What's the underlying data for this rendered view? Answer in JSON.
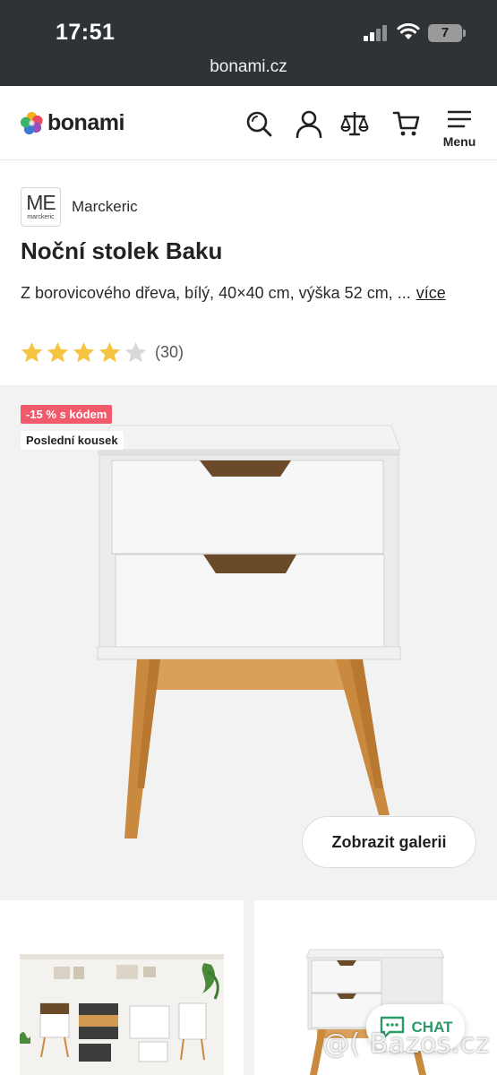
{
  "status_bar": {
    "time": "17:51",
    "battery": "7",
    "url": "bonami.cz"
  },
  "header": {
    "logo_text": "bonami",
    "icons": [
      "search-icon",
      "user-icon",
      "compare-icon",
      "cart-icon",
      "menu-icon"
    ],
    "menu_label": "Menu"
  },
  "product": {
    "brand_logo_letters": "ME",
    "brand_logo_small": "marckeric",
    "brand": "Marckeric",
    "title": "Noční stolek Baku",
    "description": "Z borovicového dřeva, bílý, 40×40 cm, výška 52 cm, ...",
    "more_link": "více",
    "rating_value": 4,
    "rating_max": 5,
    "rating_count": "(30)"
  },
  "gallery": {
    "badge_discount": "-15 % s kódem",
    "badge_last": "Poslední kousek",
    "show_gallery_button": "Zobrazit galerii"
  },
  "chat": {
    "label": "CHAT"
  },
  "watermark": "@( Bazos.cz",
  "colors": {
    "status_bar_bg": "#2f3336",
    "discount_badge": "#f05a6a",
    "chat_green": "#2a9a68",
    "star_filled": "#f5c542",
    "star_empty": "#d9d9d9",
    "gallery_bg": "#f2f2f2"
  }
}
